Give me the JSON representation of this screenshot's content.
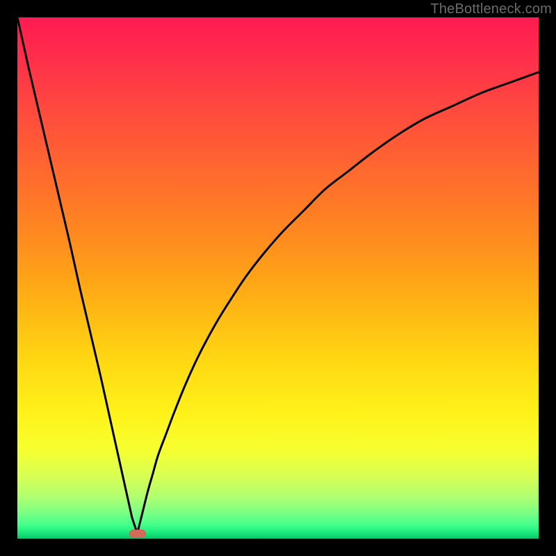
{
  "watermark": "TheBottleneck.com",
  "colors": {
    "curve_stroke": "#000000",
    "marker_fill": "#d46a5a",
    "frame_bg": "#000000"
  },
  "chart_data": {
    "type": "line",
    "title": "",
    "xlabel": "",
    "ylabel": "",
    "xlim": [
      0,
      100
    ],
    "ylim": [
      0,
      100
    ],
    "grid": false,
    "legend": false,
    "annotations": [
      {
        "kind": "marker",
        "shape": "pill",
        "x": 23,
        "y": 1
      }
    ],
    "series": [
      {
        "name": "left-branch",
        "x": [
          0,
          2,
          4,
          6,
          8,
          10,
          12,
          14,
          16,
          18,
          20,
          21,
          22,
          23
        ],
        "y": [
          100,
          91,
          82.5,
          74,
          65.5,
          57,
          48,
          39.5,
          31,
          22,
          13,
          8.5,
          4,
          1
        ]
      },
      {
        "name": "right-branch",
        "x": [
          23,
          24,
          25,
          26,
          27,
          28.5,
          30,
          32,
          34,
          36,
          38.5,
          41,
          44,
          47.5,
          51,
          55,
          59,
          63.5,
          68,
          73,
          78,
          83.5,
          89,
          94.5,
          100
        ],
        "y": [
          1,
          5,
          9,
          12.5,
          16,
          20,
          24,
          29,
          33.5,
          37.5,
          42,
          46,
          50.5,
          55,
          59,
          63,
          67,
          70.5,
          74,
          77.5,
          80.5,
          83,
          85.5,
          87.5,
          89.5
        ]
      }
    ]
  }
}
